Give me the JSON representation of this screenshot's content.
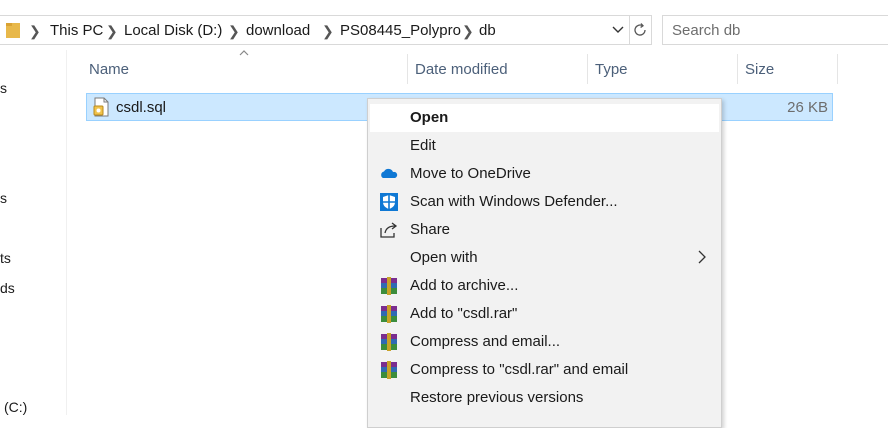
{
  "address_bar": {
    "crumbs": [
      "This PC",
      "Local Disk (D:)",
      "download",
      "PS08445_Polypro",
      "db"
    ]
  },
  "search": {
    "placeholder": "Search db"
  },
  "nav_fragments": [
    "s",
    "s",
    "ts",
    "ds",
    "(C:)"
  ],
  "columns": {
    "name": "Name",
    "date": "Date modified",
    "type": "Type",
    "size": "Size"
  },
  "file": {
    "name": "csdl.sql",
    "size": "26 KB"
  },
  "context_menu": {
    "items": [
      {
        "label": "Open",
        "icon": "none"
      },
      {
        "label": "Edit",
        "icon": "none"
      },
      {
        "label": "Move to OneDrive",
        "icon": "onedrive-icon"
      },
      {
        "label": "Scan with Windows Defender...",
        "icon": "defender-icon"
      },
      {
        "label": "Share",
        "icon": "share-icon"
      },
      {
        "label": "Open with",
        "icon": "none"
      },
      {
        "label": "Add to archive...",
        "icon": "winrar-icon"
      },
      {
        "label": "Add to \"csdl.rar\"",
        "icon": "winrar-icon"
      },
      {
        "label": "Compress and email...",
        "icon": "winrar-icon"
      },
      {
        "label": "Compress to \"csdl.rar\" and email",
        "icon": "winrar-icon"
      },
      {
        "label": "Restore previous versions",
        "icon": "none"
      }
    ]
  },
  "colors": {
    "selection": "#cce8ff",
    "selection_border": "#99d1ff",
    "header_text": "#4c607a",
    "onedrive": "#0f78d4",
    "defender": "#0f78d4"
  }
}
